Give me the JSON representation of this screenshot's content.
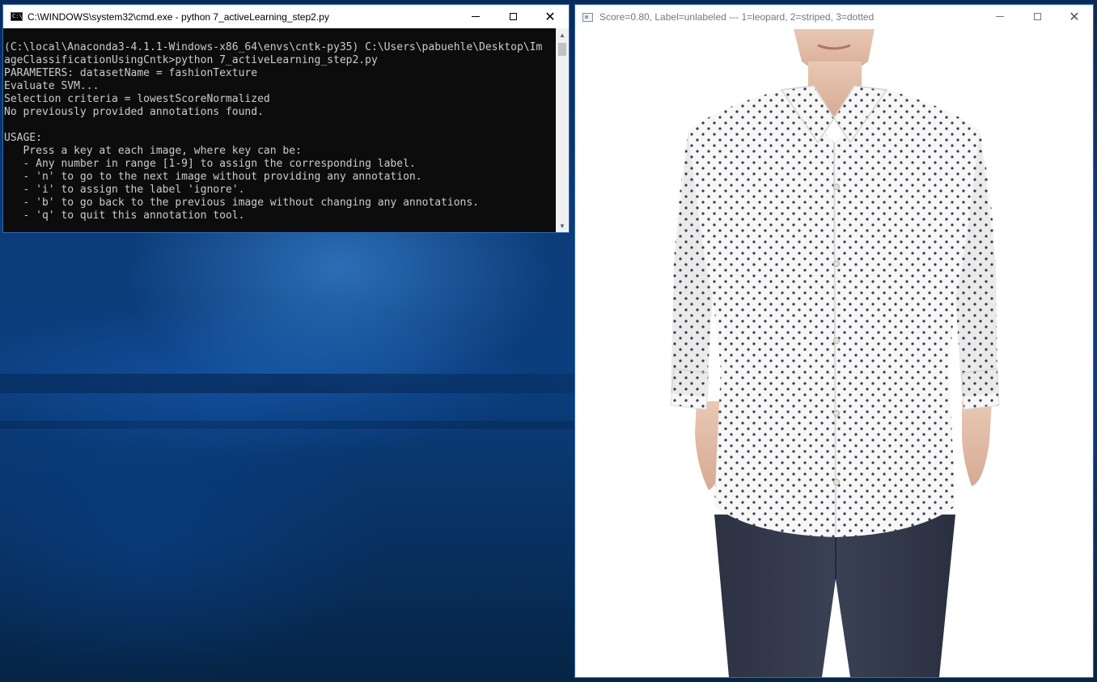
{
  "cmd_window": {
    "title": "C:\\WINDOWS\\system32\\cmd.exe - python  7_activeLearning_step2.py",
    "icon": "cmd-icon",
    "console_text": "(C:\\local\\Anaconda3-4.1.1-Windows-x86_64\\envs\\cntk-py35) C:\\Users\\pabuehle\\Desktop\\Im\nageClassificationUsingCntk>python 7_activeLearning_step2.py\nPARAMETERS: datasetName = fashionTexture\nEvaluate SVM...\nSelection criteria = lowestScoreNormalized\nNo previously provided annotations found.\n\nUSAGE:\n   Press a key at each image, where key can be:\n   - Any number in range [1-9] to assign the corresponding label.\n   - 'n' to go to the next image without providing any annotation.\n   - 'i' to assign the label 'ignore'.\n   - 'b' to go back to the previous image without changing any annotations.\n   - 'q' to quit this annotation tool."
  },
  "viewer_window": {
    "title": "Score=0.80, Label=unlabeled --- 1=leopard, 2=striped, 3=dotted",
    "icon": "image-window-icon",
    "image": "dotted-white-shirt-photo"
  },
  "window_controls": {
    "minimize": "minimize-icon",
    "maximize": "maximize-icon",
    "close": "close-icon"
  },
  "colors": {
    "console_bg": "#0c0c0c",
    "console_text": "#cccccc",
    "window_border": "#2f6bbd",
    "desktop": "#0b3e7e"
  }
}
